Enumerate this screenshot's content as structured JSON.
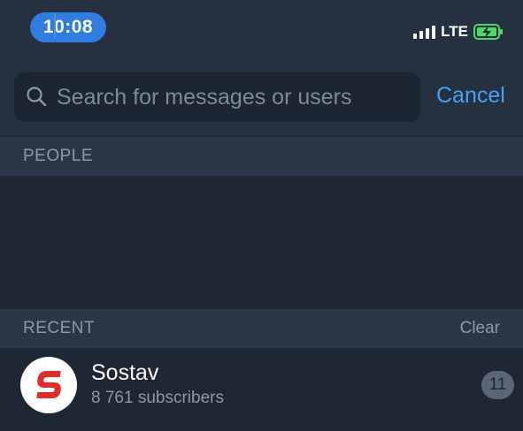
{
  "status_bar": {
    "time": "10:08",
    "network": "LTE",
    "battery_color": "#4cd964",
    "accent": "#2f7de0"
  },
  "search": {
    "placeholder": "Search for messages or users",
    "value": "",
    "cancel_label": "Cancel",
    "icon": "search-icon"
  },
  "sections": {
    "people": {
      "title": "PEOPLE"
    },
    "recent": {
      "title": "RECENT",
      "clear_label": "Clear"
    }
  },
  "recent_items": [
    {
      "name": "Sostav",
      "subtitle": "8 761 subscribers",
      "badge": "11",
      "avatar_letter": "S",
      "avatar_color": "#e32b2b"
    }
  ]
}
